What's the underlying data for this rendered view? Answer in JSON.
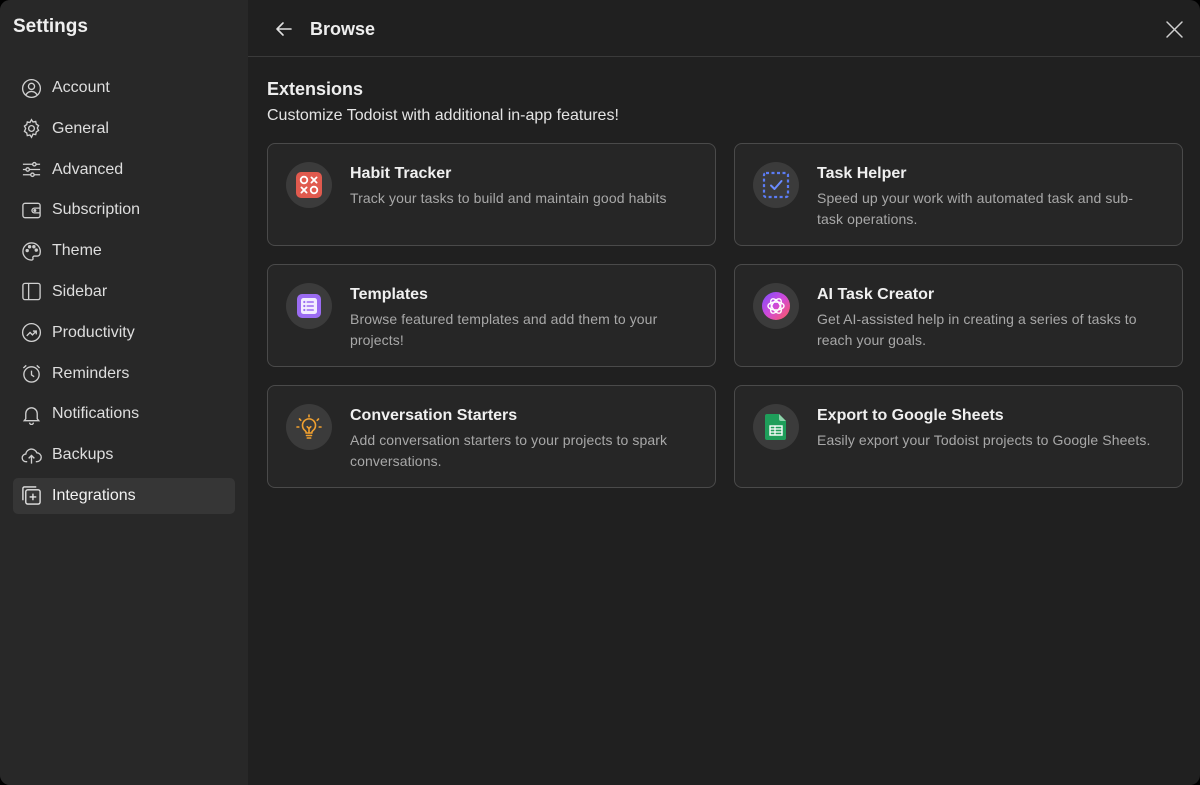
{
  "sidebar": {
    "title": "Settings",
    "items": [
      {
        "label": "Account"
      },
      {
        "label": "General"
      },
      {
        "label": "Advanced"
      },
      {
        "label": "Subscription"
      },
      {
        "label": "Theme"
      },
      {
        "label": "Sidebar"
      },
      {
        "label": "Productivity"
      },
      {
        "label": "Reminders"
      },
      {
        "label": "Notifications"
      },
      {
        "label": "Backups"
      },
      {
        "label": "Integrations",
        "active": true
      }
    ]
  },
  "header": {
    "title": "Browse"
  },
  "extensions": {
    "title": "Extensions",
    "subtitle": "Customize Todoist with additional in-app features!",
    "cards": [
      {
        "title": "Habit Tracker",
        "description": "Track your tasks to build and maintain good habits",
        "icon": "habit-tracker-icon"
      },
      {
        "title": "Task Helper",
        "description": "Speed up your work with automated task and sub-task operations.",
        "icon": "task-helper-icon"
      },
      {
        "title": "Templates",
        "description": "Browse featured templates and add them to your projects!",
        "icon": "templates-icon"
      },
      {
        "title": "AI Task Creator",
        "description": "Get AI-assisted help in creating a series of tasks to reach your goals.",
        "icon": "ai-task-creator-icon"
      },
      {
        "title": "Conversation Starters",
        "description": "Add conversation starters to your projects to spark conversations.",
        "icon": "lightbulb-icon"
      },
      {
        "title": "Export to Google Sheets",
        "description": "Easily export your Todoist projects to Google Sheets.",
        "icon": "google-sheets-icon"
      }
    ]
  },
  "colors": {
    "background": "#202020",
    "sidebar": "#282828",
    "active_item": "#363636",
    "card_border": "#4a4a4a",
    "habit_red": "#e05a4e",
    "templates_purple": "#9b6cf2",
    "sheets_green": "#1e9e5a",
    "bulb_orange": "#f0a030"
  }
}
